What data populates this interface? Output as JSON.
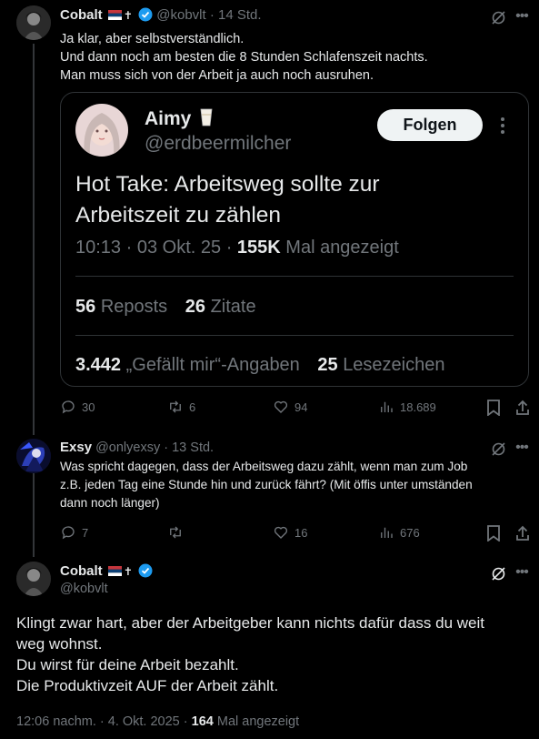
{
  "tweet1": {
    "name": "Cobalt",
    "handle": "@kobvlt",
    "time": "14 Std.",
    "line1": "Ja klar, aber selbstverständlich.",
    "line2": "Und dann noch am besten die 8 Stunden Schlafenszeit nachts.",
    "line3": "Man muss sich von der Arbeit ja auch noch ausruhen.",
    "quote": {
      "name": "Aimy",
      "handle": "@erdbeermilcher",
      "follow_label": "Folgen",
      "text_line1": "Hot Take: Arbeitsweg sollte zur",
      "text_line2": "Arbeitszeit zu zählen",
      "time": "10:13",
      "date": "03 Okt. 25",
      "views": "155K",
      "views_label": "Mal angezeigt",
      "reposts_count": "56",
      "reposts_label": "Reposts",
      "quotes_count": "26",
      "quotes_label": "Zitate",
      "likes_count": "3.442",
      "likes_label": "„Gefällt mir“-Angaben",
      "bookmarks_count": "25",
      "bookmarks_label": "Lesezeichen"
    },
    "replies": "30",
    "reposts": "6",
    "likes": "94",
    "views": "18.689"
  },
  "tweet2": {
    "name": "Exsy",
    "handle": "@onlyexsy",
    "time": "13 Std.",
    "line1": "Was spricht dagegen, dass der Arbeitsweg dazu zählt, wenn man zum Job",
    "line2": "z.B. jeden Tag eine Stunde hin und zurück fährt? (Mit öffis unter umständen",
    "line3": "dann noch länger)",
    "replies": "7",
    "likes": "16",
    "views": "676"
  },
  "tweet3": {
    "name": "Cobalt",
    "handle": "@kobvlt",
    "line1": "Klingt zwar hart, aber der Arbeitgeber kann nichts dafür dass du weit",
    "line2": "weg wohnst.",
    "line3": "Du wirst für deine Arbeit bezahlt.",
    "line4": "Die Produktivzeit AUF der Arbeit zählt.",
    "timestamp": "12:06 nachm. · 4. Okt. 2025 · ",
    "views": "164",
    "views_label": "Mal angezeigt"
  },
  "colors": {
    "accent": "#1d9bf0",
    "text": "#e7e9ea",
    "muted": "#71767b",
    "border": "#2f3336"
  }
}
